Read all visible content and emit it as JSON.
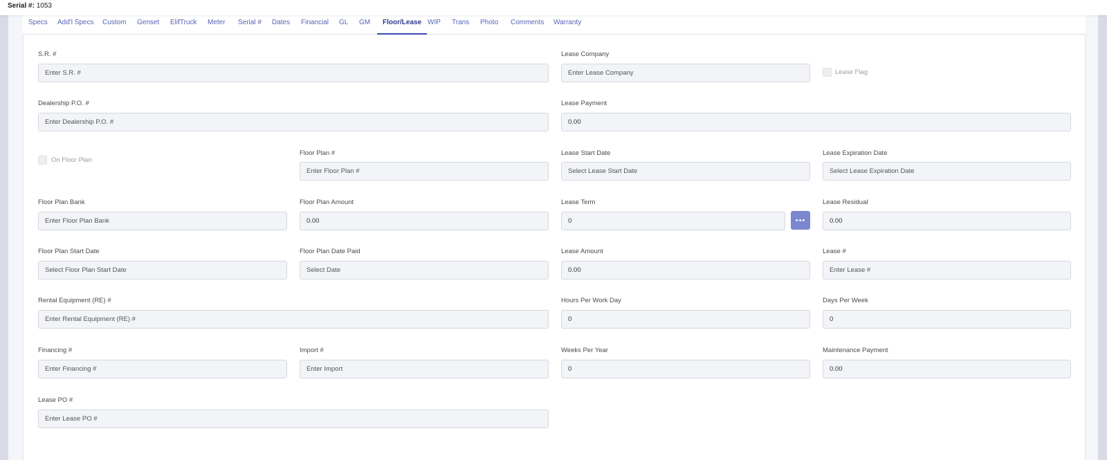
{
  "header": {
    "serial_label": "Serial #:",
    "serial_value": "1053"
  },
  "tabs": [
    "Specs",
    "Add'l Specs",
    "Custom",
    "Genset",
    "ElifTruck",
    "Meter",
    "Serial #",
    "Dates",
    "Financial",
    "GL",
    "GM",
    "Floor/Lease",
    "WIP",
    "Trans",
    "Photo",
    "Comments",
    "Warranty"
  ],
  "active_tab": "Floor/Lease",
  "form": {
    "sr": {
      "label": "S.R. #",
      "placeholder": "Enter S.R. #"
    },
    "lease_company": {
      "label": "Lease Company",
      "placeholder": "Enter Lease Company"
    },
    "lease_flag": {
      "label": "Lease Flag",
      "checked": false
    },
    "dealership_po": {
      "label": "Dealership P.O. #",
      "placeholder": "Enter Dealership P.O. #"
    },
    "lease_payment": {
      "label": "Lease Payment",
      "value": "0.00"
    },
    "on_floor_plan": {
      "label": "On Floor Plan",
      "checked": false
    },
    "floor_plan_num": {
      "label": "Floor Plan #",
      "placeholder": "Enter Floor Plan #"
    },
    "lease_start_date": {
      "label": "Lease Start Date",
      "placeholder": "Select Lease Start Date"
    },
    "lease_expiration_date": {
      "label": "Lease Expiration Date",
      "placeholder": "Select Lease Expiration Date"
    },
    "floor_plan_bank": {
      "label": "Floor Plan Bank",
      "placeholder": "Enter Floor Plan Bank"
    },
    "floor_plan_amount": {
      "label": "Floor Plan Amount",
      "value": "0.00"
    },
    "lease_term": {
      "label": "Lease Term",
      "value": "0"
    },
    "lease_residual": {
      "label": "Lease Residual",
      "value": "0.00"
    },
    "floor_plan_start_date": {
      "label": "Floor Plan Start Date",
      "placeholder": "Select Floor Plan Start Date"
    },
    "floor_plan_date_paid": {
      "label": "Floor Plan Date Paid",
      "placeholder": "Select Date"
    },
    "lease_amount": {
      "label": "Lease Amount",
      "value": "0.00"
    },
    "lease_num": {
      "label": "Lease #",
      "placeholder": "Enter Lease #"
    },
    "rental_equipment": {
      "label": "Rental Equipment (RE) #",
      "placeholder": "Enter Rental Equipment (RE) #"
    },
    "hours_per_work_day": {
      "label": "Hours Per Work Day",
      "value": "0"
    },
    "days_per_week": {
      "label": "Days Per Week",
      "value": "0"
    },
    "financing_num": {
      "label": "Financing #",
      "placeholder": "Enter Financing #"
    },
    "import_num": {
      "label": "Import #",
      "placeholder": "Enter Import"
    },
    "weeks_per_year": {
      "label": "Weeks Per Year",
      "value": "0"
    },
    "maintenance_payment": {
      "label": "Maintenance Payment",
      "value": "0.00"
    },
    "lease_po": {
      "label": "Lease PO #",
      "placeholder": "Enter Lease PO #"
    }
  },
  "more_button_icon": "ellipsis-icon",
  "colors": {
    "accent": "#3b47b0",
    "tab_text": "#5863b8",
    "button": "#7b87cf"
  }
}
